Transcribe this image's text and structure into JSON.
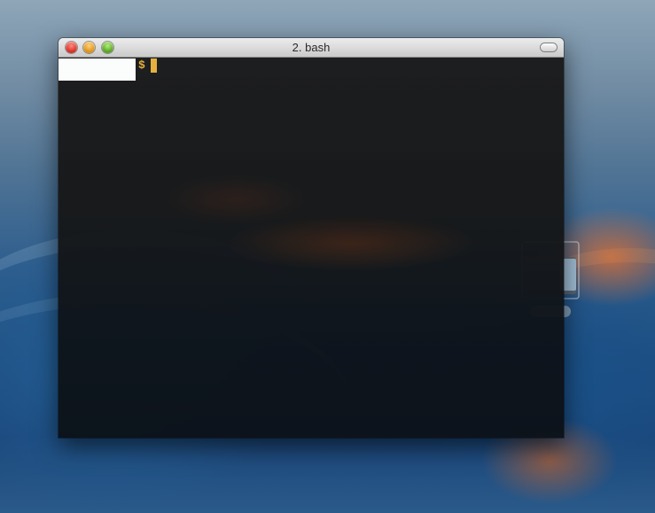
{
  "window": {
    "title": "2. bash"
  },
  "terminal": {
    "prompt_symbol": "$",
    "hostname_redacted": true,
    "cursor": "block"
  },
  "icons": {
    "close": "close-icon",
    "minimize": "minimize-icon",
    "zoom": "zoom-icon",
    "toolbar_toggle": "toolbar-toggle-icon",
    "desktop_item": "external-drive-icon"
  },
  "colors": {
    "prompt": "#e9b13b",
    "cursor": "#e9b13b",
    "terminal_background": "#171819",
    "redaction": "#ffffff"
  }
}
